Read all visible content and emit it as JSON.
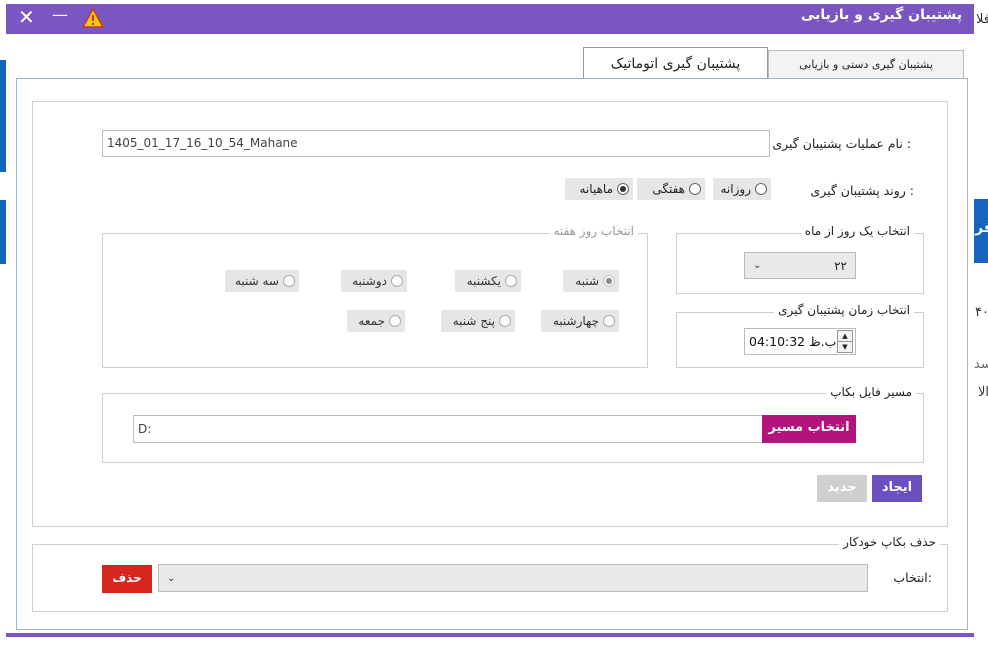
{
  "background": {
    "frag_1": "فلا",
    "frag_2": "فر",
    "frag_3": "۴۰",
    "frag_4": "سد",
    "frag_5": "الا"
  },
  "window": {
    "title": "پشتیبان گیری و بازیابی",
    "close_glyph": "✕",
    "minimize_glyph": "—"
  },
  "tabs": {
    "manual": "پشتیبان گیری دستی و بازیابی",
    "auto": "پشتیبان گیری اتوماتیک"
  },
  "form": {
    "op_name_label": "نام عملیات پشتیبان گیری :",
    "op_name_value": "1405_01_17_16_10_54_Mahane",
    "routine_label": "روند پشتیبان گیری :",
    "routine_options": [
      {
        "label": "روزانه",
        "checked": false
      },
      {
        "label": "هفتگی",
        "checked": false
      },
      {
        "label": "ماهیانه",
        "checked": true
      }
    ],
    "month_day_legend": "انتخاب یک روز از ماه",
    "month_day_value": "۲۲",
    "time_legend": "انتخاب زمان پشتیبان گیری",
    "time_value": "ب.ظ 04:10:32",
    "weekday_legend": "انتخاب روز هفته",
    "weekdays": [
      "شنبه",
      "یکشنبه",
      "دوشنبه",
      "سه شنبه",
      "چهارشنبه",
      "پنج شنبه",
      "جمعه"
    ],
    "path_legend": "مسیر فایل بکاپ",
    "path_value": "D:",
    "choose_path_button": "انتخاب مسیر",
    "create_button": "ایجاد",
    "new_button": "جدید"
  },
  "delete_section": {
    "legend": "حذف بکاپ خودکار",
    "select_label": "انتخاب:",
    "select_value": "",
    "delete_button": "حذف"
  },
  "colors": {
    "titlebar": "#7a56c0",
    "choose_path": "#b4127d",
    "create": "#6a4fc0",
    "delete": "#d7261e"
  }
}
